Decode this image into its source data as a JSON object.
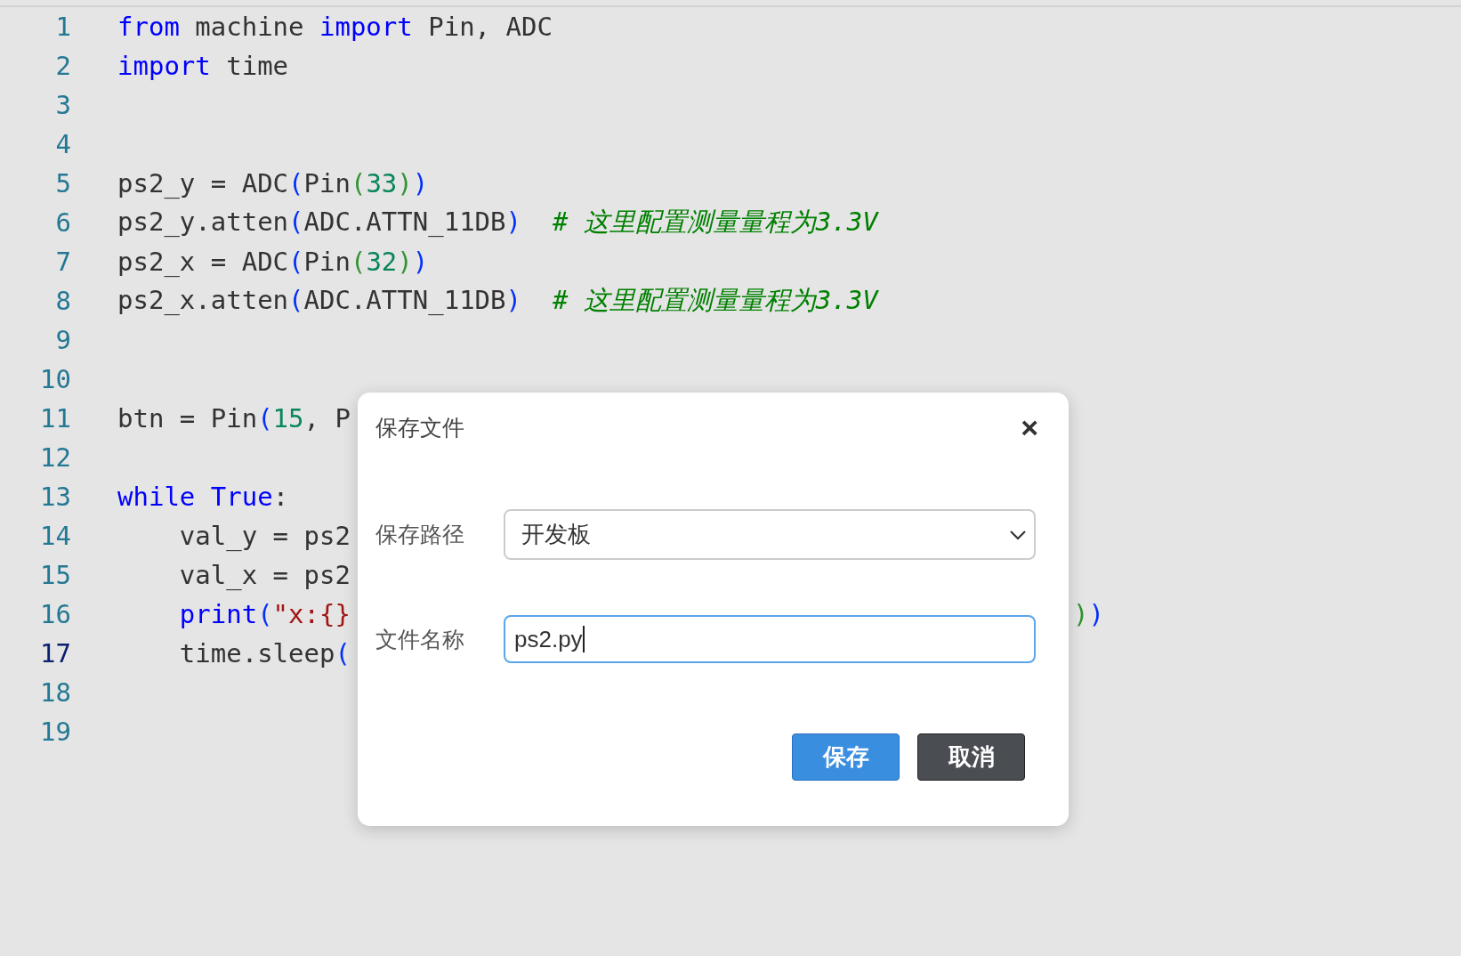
{
  "editor": {
    "lines": [
      {
        "number": "1",
        "active": false,
        "tokens": [
          {
            "kind": "kw",
            "text": "from"
          },
          {
            "kind": "plain",
            "text": " machine "
          },
          {
            "kind": "kw",
            "text": "import"
          },
          {
            "kind": "plain",
            "text": " Pin, ADC"
          }
        ]
      },
      {
        "number": "2",
        "active": false,
        "tokens": [
          {
            "kind": "kw",
            "text": "import"
          },
          {
            "kind": "plain",
            "text": " time"
          }
        ]
      },
      {
        "number": "3",
        "active": false
      },
      {
        "number": "4",
        "active": false
      },
      {
        "number": "5",
        "active": false,
        "tokens": [
          {
            "kind": "plain",
            "text": "ps2_y = ADC"
          },
          {
            "kind": "p1",
            "text": "("
          },
          {
            "kind": "plain",
            "text": "Pin"
          },
          {
            "kind": "p2",
            "text": "("
          },
          {
            "kind": "num",
            "text": "33"
          },
          {
            "kind": "p2",
            "text": ")"
          },
          {
            "kind": "p1",
            "text": ")"
          }
        ]
      },
      {
        "number": "6",
        "active": false,
        "tokens": [
          {
            "kind": "plain",
            "text": "ps2_y.atten"
          },
          {
            "kind": "p1",
            "text": "("
          },
          {
            "kind": "plain",
            "text": "ADC.ATTN_11DB"
          },
          {
            "kind": "p1",
            "text": ")"
          },
          {
            "kind": "comment",
            "text": "# 这里配置测量量程为3.3V"
          }
        ]
      },
      {
        "number": "7",
        "active": false,
        "tokens": [
          {
            "kind": "plain",
            "text": "ps2_x = ADC"
          },
          {
            "kind": "p1",
            "text": "("
          },
          {
            "kind": "plain",
            "text": "Pin"
          },
          {
            "kind": "p2",
            "text": "("
          },
          {
            "kind": "num",
            "text": "32"
          },
          {
            "kind": "p2",
            "text": ")"
          },
          {
            "kind": "p1",
            "text": ")"
          }
        ]
      },
      {
        "number": "8",
        "active": false,
        "tokens": [
          {
            "kind": "plain",
            "text": "ps2_x.atten"
          },
          {
            "kind": "p1",
            "text": "("
          },
          {
            "kind": "plain",
            "text": "ADC.ATTN_11DB"
          },
          {
            "kind": "p1",
            "text": ")"
          },
          {
            "kind": "comment",
            "text": "# 这里配置测量量程为3.3V"
          }
        ]
      },
      {
        "number": "9",
        "active": false
      },
      {
        "number": "10",
        "active": false
      },
      {
        "number": "11",
        "active": false,
        "tokens": [
          {
            "kind": "plain",
            "text": "btn = Pin"
          },
          {
            "kind": "p1",
            "text": "("
          },
          {
            "kind": "num",
            "text": "15"
          },
          {
            "kind": "plain",
            "text": ", P"
          }
        ]
      },
      {
        "number": "12",
        "active": false
      },
      {
        "number": "13",
        "active": false,
        "tokens": [
          {
            "kind": "kw",
            "text": "while"
          },
          {
            "kind": "kw",
            "text": " True"
          },
          {
            "kind": "plain",
            "text": ":"
          }
        ]
      },
      {
        "number": "14",
        "active": false,
        "indented": true,
        "tokens": [
          {
            "kind": "plain",
            "text": "val_y = ps2"
          }
        ]
      },
      {
        "number": "15",
        "active": false,
        "indented": true,
        "tokens": [
          {
            "kind": "plain",
            "text": "val_x = ps2"
          }
        ]
      },
      {
        "number": "16",
        "active": false,
        "indented": true,
        "tokens": [
          {
            "kind": "kw",
            "text": "print"
          },
          {
            "kind": "p1",
            "text": "("
          },
          {
            "kind": "str",
            "text": "\"x:{}"
          }
        ],
        "tail": [
          {
            "kind": "p2",
            "text": ")"
          },
          {
            "kind": "p1",
            "text": ")"
          }
        ]
      },
      {
        "number": "17",
        "active": true,
        "indented": true,
        "tokens": [
          {
            "kind": "plain",
            "text": "time.sleep"
          },
          {
            "kind": "p1",
            "text": "("
          }
        ]
      },
      {
        "number": "18",
        "active": false
      },
      {
        "number": "19",
        "active": false
      }
    ]
  },
  "dialog": {
    "title": "保存文件",
    "close": "×",
    "path": {
      "label": "保存路径",
      "value": "开发板"
    },
    "filename": {
      "label": "文件名称",
      "value": "ps2.py",
      "focused": true
    },
    "buttons": [
      {
        "label": "保存",
        "kind": "primary"
      },
      {
        "label": "取消",
        "kind": "secondary"
      }
    ]
  }
}
